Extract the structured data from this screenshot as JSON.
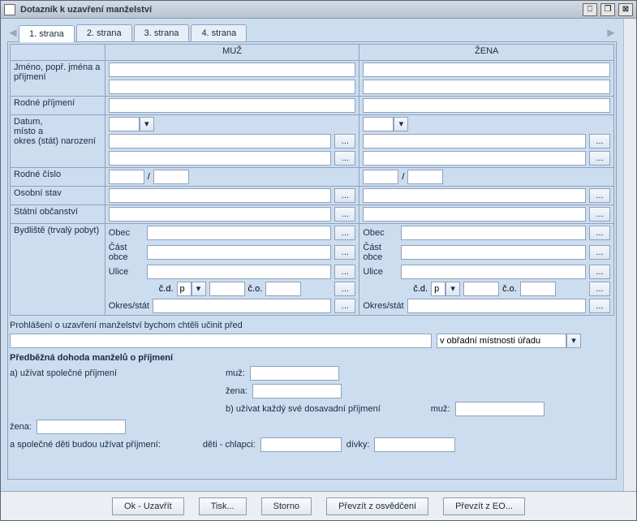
{
  "window": {
    "title": "Dotazník k uzavření manželství",
    "minimize": "⎕",
    "maximize": "❐",
    "close": "⊠"
  },
  "tabs": {
    "left_arrow": "◀",
    "right_arrow": "▶",
    "items": [
      "1. strana",
      "2. strana",
      "3. strana",
      "4. strana"
    ]
  },
  "headers": {
    "empty": "",
    "man": "MUŽ",
    "woman": "ŽENA"
  },
  "rows": {
    "name": "Jméno, popř. jména a příjmení",
    "birth_name": "Rodné příjmení",
    "birth": "Datum,\nmísto a\nokres (stát) narození",
    "rc": "Rodné číslo",
    "rc_sep": "/",
    "status": "Osobní stav",
    "citizenship": "Státní občanství",
    "residence": "Bydliště (trvalý pobyt)"
  },
  "sublabels": {
    "obec": "Obec",
    "cast": "Část obce",
    "ulice": "Ulice",
    "cd": "č.d.",
    "p": "p",
    "co": "č.o.",
    "okres": "Okres/stát"
  },
  "decl": {
    "text": "Prohlášení o uzavření manželství bychom chtěli učinit před",
    "place": "v obřadní místnosti úřadu"
  },
  "surname": {
    "heading": "Předběžná dohoda manželů o příjmení",
    "opt_a": "a) užívat společné příjmení",
    "muz": "muž:",
    "zena": "žena:",
    "opt_b": "b) užívat každý své dosavadní příjmení",
    "zena2": "žena:",
    "kids_text": "a společné děti budou užívat příjmení:",
    "boys": "děti - chlapci:",
    "girls": "dívky:"
  },
  "bottom": {
    "ok": "Ok - Uzavřít",
    "print": "Tisk...",
    "cancel": "Storno",
    "from_cert": "Převzít z osvědčení",
    "from_eo": "Převzít z EO..."
  },
  "ellipsis": "...",
  "arrow_down": "▾"
}
